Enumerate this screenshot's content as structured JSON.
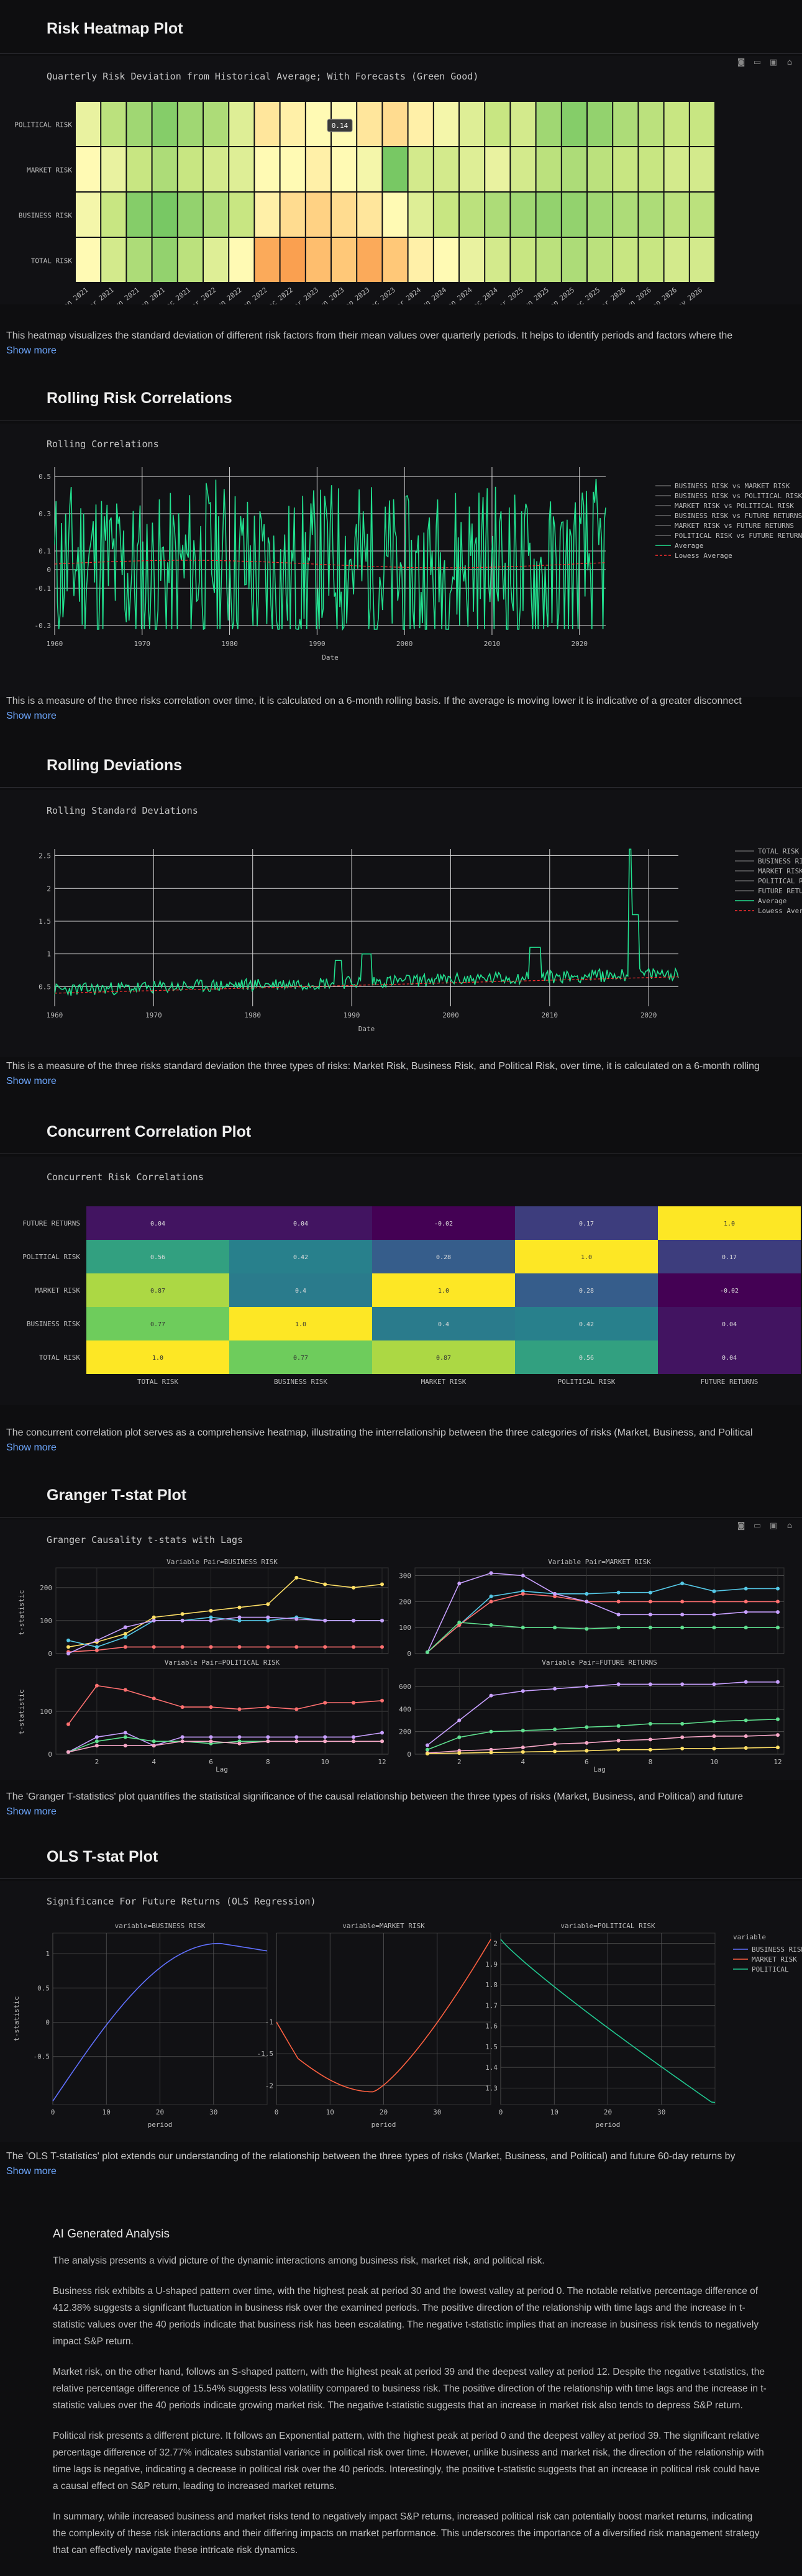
{
  "colors": {
    "background": "#0e0e10",
    "link": "#6ea8ff",
    "accent_green": "#22e08f",
    "lowess_red": "#ff3030"
  },
  "heatmap": {
    "title": "Risk Heatmap Plot",
    "subtitle": "Quarterly Risk Deviation from Historical Average; With Forecasts (Green Good)",
    "rows": [
      "POLITICAL RISK",
      "MARKET RISK",
      "BUSINESS RISK",
      "TOTAL RISK"
    ],
    "columns": [
      "Jan 2021",
      "Mar 2021",
      "Jun 2021",
      "Sep 2021",
      "Dec 2021",
      "Mar 2022",
      "Jun 2022",
      "Sep 2022",
      "Dec 2022",
      "Mar 2023",
      "Jun 2023",
      "Sep 2023",
      "Dec 2023",
      "Mar 2024",
      "Jun 2024",
      "Sep 2024",
      "Dec 2024",
      "Mar 2025",
      "Jun 2025",
      "Sep 2025",
      "Dec 2025",
      "Mar 2026",
      "Jun 2026",
      "Sep 2026",
      "Nov 2026"
    ],
    "values": [
      [
        0.45,
        0.25,
        0.15,
        0.05,
        0.15,
        0.2,
        0.4,
        0.65,
        0.6,
        0.55,
        0.55,
        0.65,
        0.7,
        0.6,
        0.5,
        0.4,
        0.3,
        0.35,
        0.15,
        0.05,
        0.1,
        0.2,
        0.25,
        0.3,
        0.3
      ],
      [
        0.55,
        0.45,
        0.3,
        0.2,
        0.3,
        0.35,
        0.4,
        0.55,
        0.55,
        0.6,
        0.55,
        0.5,
        0.0,
        0.35,
        0.35,
        0.4,
        0.45,
        0.35,
        0.25,
        0.2,
        0.25,
        0.3,
        0.3,
        0.35,
        0.35
      ],
      [
        0.5,
        0.3,
        0.05,
        0.0,
        0.1,
        0.2,
        0.3,
        0.6,
        0.7,
        0.75,
        0.7,
        0.65,
        0.55,
        0.4,
        0.3,
        0.25,
        0.2,
        0.15,
        0.1,
        0.1,
        0.15,
        0.2,
        0.2,
        0.25,
        0.25
      ],
      [
        0.55,
        0.35,
        0.2,
        0.1,
        0.25,
        0.4,
        0.55,
        0.95,
        1.0,
        0.85,
        0.8,
        0.95,
        0.8,
        0.6,
        0.55,
        0.45,
        0.35,
        0.3,
        0.25,
        0.2,
        0.25,
        0.3,
        0.3,
        0.35,
        0.35
      ]
    ],
    "tooltip": "0.14",
    "description": "This heatmap visualizes the standard deviation of different risk factors from their mean values over quarterly periods. It helps to identify periods and factors where the",
    "show_more": "Show more"
  },
  "rolling_corr": {
    "title": "Rolling Risk Correlations",
    "subtitle": "Rolling Correlations",
    "xlabel": "Date",
    "x_ticks": [
      "1960",
      "1970",
      "1980",
      "1990",
      "2000",
      "2010",
      "2020"
    ],
    "y_ticks": [
      "0.5",
      "0.3",
      "0.1",
      "0",
      "-0.1",
      "-0.3"
    ],
    "legend": [
      "BUSINESS RISK vs MARKET RISK",
      "BUSINESS RISK vs POLITICAL RISK",
      "MARKET RISK vs POLITICAL RISK",
      "BUSINESS RISK vs FUTURE RETURNS",
      "MARKET RISK vs FUTURE RETURNS",
      "POLITICAL RISK vs FUTURE RETURNS",
      "Average",
      "Lowess Average"
    ],
    "description": "This is a measure of the three risks correlation over time, it is calculated on a 6-month rolling basis. If the average is moving lower it is indicative of a greater disconnect",
    "show_more": "Show more"
  },
  "rolling_dev": {
    "title": "Rolling Deviations",
    "subtitle": "Rolling Standard Deviations",
    "xlabel": "Date",
    "x_ticks": [
      "1960",
      "1970",
      "1980",
      "1990",
      "2000",
      "2010",
      "2020"
    ],
    "y_ticks": [
      "2.5",
      "2",
      "1.5",
      "1",
      "0.5"
    ],
    "legend": [
      "TOTAL RISK",
      "BUSINESS RISK",
      "MARKET RISK",
      "POLITICAL RISK",
      "FUTURE RETURNS",
      "Average",
      "Lowess Average"
    ],
    "description": "This is a measure of the three risks standard deviation the three types of risks: Market Risk, Business Risk, and Political Risk, over time, it is calculated on a 6-month rolling",
    "show_more": "Show more"
  },
  "concurrent": {
    "title": "Concurrent Correlation Plot",
    "subtitle": "Concurrent Risk Correlations",
    "rows": [
      "FUTURE RETURNS",
      "POLITICAL RISK",
      "MARKET RISK",
      "BUSINESS RISK",
      "TOTAL RISK"
    ],
    "columns": [
      "TOTAL RISK",
      "BUSINESS RISK",
      "MARKET RISK",
      "POLITICAL RISK",
      "FUTURE RETURNS"
    ],
    "values": [
      [
        "0.04",
        "0.04",
        "-0.02",
        "0.17",
        "1.0"
      ],
      [
        "0.56",
        "0.42",
        "0.28",
        "1.0",
        "0.17"
      ],
      [
        "0.87",
        "0.4",
        "1.0",
        "0.28",
        "-0.02"
      ],
      [
        "0.77",
        "1.0",
        "0.4",
        "0.42",
        "0.04"
      ],
      [
        "1.0",
        "0.77",
        "0.87",
        "0.56",
        "0.04"
      ]
    ],
    "description": "The concurrent correlation plot serves as a comprehensive heatmap, illustrating the interrelationship between the three categories of risks (Market, Business, and Political",
    "show_more": "Show more"
  },
  "granger": {
    "title": "Granger T-stat Plot",
    "subtitle": "Granger Causality t-stats with Lags",
    "panels": [
      "Variable Pair=BUSINESS RISK",
      "Variable Pair=MARKET RISK",
      "Variable Pair=POLITICAL RISK",
      "Variable Pair=FUTURE RETURNS"
    ],
    "xlabel": "Lag",
    "ylabel": "t-statistic",
    "x_ticks": [
      "2",
      "4",
      "6",
      "8",
      "10",
      "12"
    ],
    "panel_y_ticks": [
      [
        "0",
        "100",
        "200"
      ],
      [
        "0",
        "100",
        "200",
        "300"
      ],
      [
        "0",
        "100"
      ],
      [
        "0",
        "200",
        "400",
        "600"
      ]
    ],
    "description": "The 'Granger T-statistics' plot quantifies the statistical significance of the causal relationship between the three types of risks (Market, Business, and Political) and future",
    "show_more": "Show more"
  },
  "ols": {
    "title": "OLS T-stat Plot",
    "subtitle": "Significance For Future Returns (OLS Regression)",
    "panels": [
      "variable=BUSINESS RISK",
      "variable=MARKET RISK",
      "variable=POLITICAL RISK"
    ],
    "xlabel": "period",
    "ylabel": "t-statistic",
    "x_ticks": [
      "0",
      "10",
      "20",
      "30"
    ],
    "y_ticks_p1": [
      "1",
      "0.5",
      "0",
      "-0.5"
    ],
    "y_ticks_p2": [
      "-1",
      "-1.5",
      "-2"
    ],
    "y_ticks_p3": [
      "2",
      "1.9",
      "1.8",
      "1.7",
      "1.6",
      "1.5",
      "1.4",
      "1.3"
    ],
    "legend_title": "variable",
    "legend": [
      "BUSINESS RISK",
      "MARKET RISK",
      "POLITICAL"
    ],
    "description": "The 'OLS T-statistics' plot extends our understanding of the relationship between the three types of risks (Market, Business, and Political) and future 60-day returns by",
    "show_more": "Show more"
  },
  "ai": {
    "title": "AI Generated Analysis",
    "paragraphs": [
      "The analysis presents a vivid picture of the dynamic interactions among business risk, market risk, and political risk.",
      "Business risk exhibits a U-shaped pattern over time, with the highest peak at period 30 and the lowest valley at period 0. The notable relative percentage difference of 412.38% suggests a significant fluctuation in business risk over the examined periods. The positive direction of the relationship with time lags and the increase in t-statistic values over the 40 periods indicate that business risk has been escalating. The negative t-statistic implies that an increase in business risk tends to negatively impact S&P return.",
      "Market risk, on the other hand, follows an S-shaped pattern, with the highest peak at period 39 and the deepest valley at period 12. Despite the negative t-statistics, the relative percentage difference of 15.54% suggests less volatility compared to business risk. The positive direction of the relationship with time lags and the increase in t-statistic values over the 40 periods indicate growing market risk. The negative t-statistic suggests that an increase in market risk also tends to depress S&P return.",
      "Political risk presents a different picture. It follows an Exponential pattern, with the highest peak at period 0 and the deepest valley at period 39. The significant relative percentage difference of 32.77% indicates substantial variance in political risk over time. However, unlike business and market risk, the direction of the relationship with time lags is negative, indicating a decrease in political risk over the 40 periods. Interestingly, the positive t-statistic suggests that an increase in political risk could have a causal effect on S&P return, leading to increased market returns.",
      "In summary, while increased business and market risks tend to negatively impact S&P returns, increased political risk can potentially boost market returns, indicating the complexity of these risk interactions and their differing impacts on market performance. This underscores the importance of a diversified risk management strategy that can effectively navigate these intricate risk dynamics."
    ]
  }
}
